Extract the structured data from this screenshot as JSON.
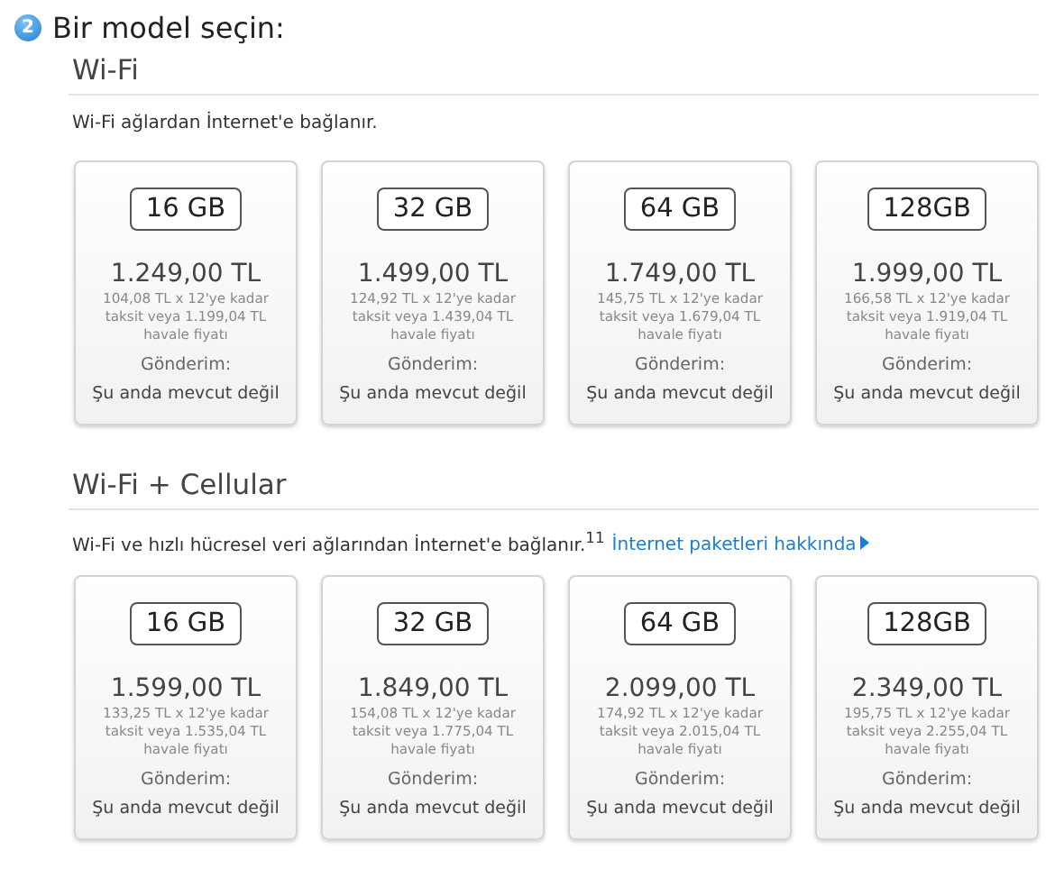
{
  "step": {
    "number": "2",
    "title": "Bir model seçin:"
  },
  "sections": [
    {
      "heading": "Wi-Fi",
      "description": "Wi-Fi ağlardan İnternet'e bağlanır.",
      "models": [
        {
          "capacity": "16 GB",
          "price": "1.249,00 TL",
          "installment": "104,08 TL x 12'ye kadar taksit veya 1.199,04 TL havale fiyatı",
          "shipping_label": "Gönderim:",
          "shipping": "Şu anda mevcut değil"
        },
        {
          "capacity": "32 GB",
          "price": "1.499,00 TL",
          "installment": "124,92 TL x 12'ye kadar taksit veya 1.439,04 TL havale fiyatı",
          "shipping_label": "Gönderim:",
          "shipping": "Şu anda mevcut değil"
        },
        {
          "capacity": "64 GB",
          "price": "1.749,00 TL",
          "installment": "145,75 TL x 12'ye kadar taksit veya 1.679,04 TL havale fiyatı",
          "shipping_label": "Gönderim:",
          "shipping": "Şu anda mevcut değil"
        },
        {
          "capacity": "128GB",
          "price": "1.999,00 TL",
          "installment": "166,58 TL x 12'ye kadar taksit veya 1.919,04 TL havale fiyatı",
          "shipping_label": "Gönderim:",
          "shipping": "Şu anda mevcut değil"
        }
      ]
    },
    {
      "heading": "Wi-Fi + Cellular",
      "description": "Wi-Fi ve hızlı hücresel veri ağlarından İnternet'e bağlanır.$^{11}$",
      "link": "İnternet paketleri hakkında",
      "models": [
        {
          "capacity": "16 GB",
          "price": "1.599,00 TL",
          "installment": "133,25 TL x 12'ye kadar taksit veya 1.535,04 TL havale fiyatı",
          "shipping_label": "Gönderim:",
          "shipping": "Şu anda mevcut değil"
        },
        {
          "capacity": "32 GB",
          "price": "1.849,00 TL",
          "installment": "154,08 TL x 12'ye kadar taksit veya 1.775,04 TL havale fiyatı",
          "shipping_label": "Gönderim:",
          "shipping": "Şu anda mevcut değil"
        },
        {
          "capacity": "64 GB",
          "price": "2.099,00 TL",
          "installment": "174,92 TL x 12'ye kadar taksit veya 2.015,04 TL havale fiyatı",
          "shipping_label": "Gönderim:",
          "shipping": "Şu anda mevcut değil"
        },
        {
          "capacity": "128GB",
          "price": "2.349,00 TL",
          "installment": "195,75 TL x 12'ye kadar taksit veya 2.255,04 TL havale fiyatı",
          "shipping_label": "Gönderim:",
          "shipping": "Şu anda mevcut değil"
        }
      ]
    }
  ]
}
